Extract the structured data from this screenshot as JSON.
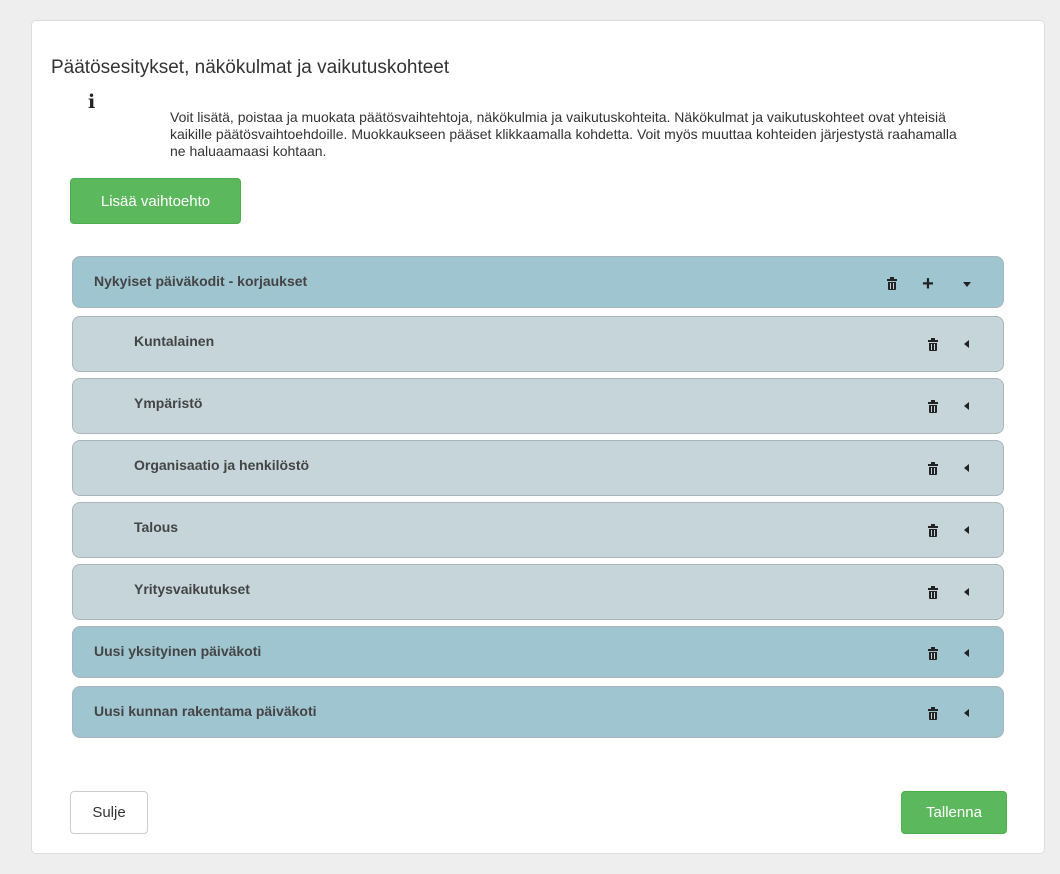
{
  "dialog": {
    "title": "Päätösesitykset, näkökulmat ja vaikutuskohteet",
    "info_icon": "info-icon",
    "info_text": "Voit lisätä, poistaa ja muokata päätösvaihtehtoja, näkökulmia ja vaikutuskohteita. Näkökulmat ja vaikutuskohteet ovat yhteisiä kaikille päätösvaihtoehdoille. Muokkaukseen pääset klikkaamalla kohdetta. Voit myös muuttaa kohteiden järjestystä raahamalla ne haluaamaasi kohtaan.",
    "add_button": "Lisää vaihtoehto",
    "close_button": "Sulje",
    "save_button": "Tallenna"
  },
  "colors": {
    "green": "#5cb85c",
    "alt_row": "#9fc5d0",
    "sub_row": "#c5d5da"
  },
  "items": [
    {
      "label": "Nykyiset päiväkodit - korjaukset",
      "level": 0,
      "expanded": true
    },
    {
      "label": "Kuntalainen",
      "level": 1
    },
    {
      "label": "Ympäristö",
      "level": 1
    },
    {
      "label": "Organisaatio ja henkilöstö",
      "level": 1
    },
    {
      "label": "Talous",
      "level": 1
    },
    {
      "label": "Yritysvaikutukset",
      "level": 1
    },
    {
      "label": "Uusi yksityinen päiväkoti",
      "level": 0
    },
    {
      "label": "Uusi kunnan rakentama päiväkoti",
      "level": 0
    }
  ]
}
